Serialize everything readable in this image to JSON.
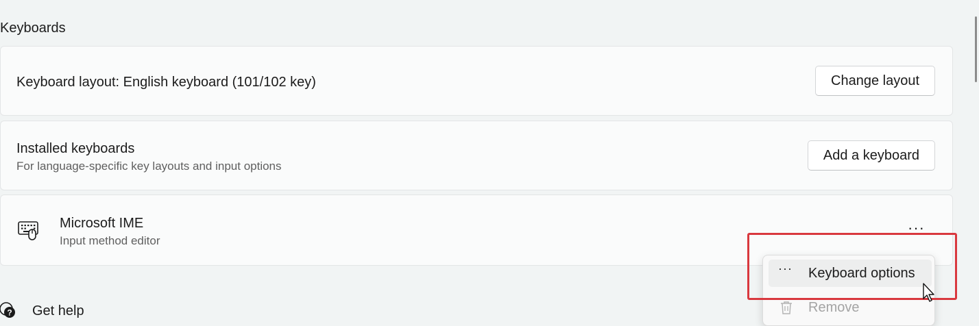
{
  "section": {
    "title": "Keyboards"
  },
  "layout_row": {
    "title": "Keyboard layout: English keyboard (101/102 key)",
    "button": "Change layout"
  },
  "installed_row": {
    "title": "Installed keyboards",
    "subtitle": "For language-specific key layouts and input options",
    "button": "Add a keyboard"
  },
  "ime_row": {
    "icon": "keyboard-icon",
    "title": "Microsoft IME",
    "subtitle": "Input method editor",
    "more": "···"
  },
  "context_menu": {
    "items": [
      {
        "icon": "more-dots-icon",
        "glyph": "···",
        "label": "Keyboard options",
        "enabled": true
      },
      {
        "icon": "trash-icon",
        "glyph": "",
        "label": "Remove",
        "enabled": false
      }
    ]
  },
  "help": {
    "icon": "help-icon",
    "label": "Get help"
  },
  "colors": {
    "highlight": "#d9383e",
    "background": "#f1f4f4",
    "card": "#fafbfb"
  }
}
